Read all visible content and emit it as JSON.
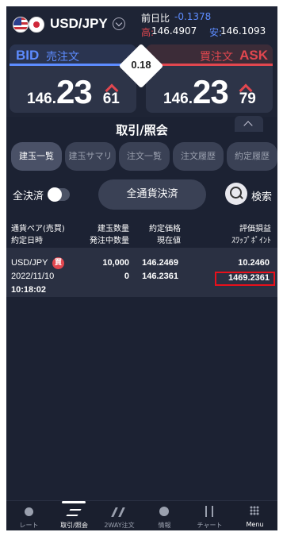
{
  "header": {
    "pair": "USD/JPY",
    "change_label": "前日比",
    "change_value": "-0.1378",
    "high_label": "高:",
    "high_value": "146.4907",
    "low_label": "安:",
    "low_value": "146.1093"
  },
  "bid": {
    "label": "BID",
    "sub": "売注文",
    "price_head": "146.",
    "price_big": "23",
    "price_tail": "61"
  },
  "ask": {
    "label": "ASK",
    "sub": "買注文",
    "price_head": "146.",
    "price_big": "23",
    "price_tail": "79"
  },
  "spread": "0.18",
  "panel_title": "取引/照会",
  "tabs": [
    "建玉一覧",
    "建玉サマリ",
    "注文一覧",
    "注文履歴",
    "約定履歴"
  ],
  "controls": {
    "settle_all_label": "全決済",
    "all_currency_button": "全通貨決済",
    "search_label": "検索"
  },
  "table": {
    "headers": {
      "col1_line1": "通貨ペア(売買)",
      "col1_line2": "約定日時",
      "col2_line1": "建玉数量",
      "col2_line2": "発注中数量",
      "col3_line1": "約定価格",
      "col3_line2": "現在値",
      "col4_line1": "評価損益",
      "col4_line2": "ｽﾜｯﾌﾟﾎﾟｲﾝﾄ"
    },
    "rows": [
      {
        "pair": "USD/JPY",
        "side": "買",
        "date": "2022/11/10",
        "time": "10:18:02",
        "qty": "10,000",
        "pending_qty": "0",
        "exec_price": "146.2469",
        "current_price": "146.2361",
        "pl": "10.2460",
        "swap": "1469.2361"
      }
    ]
  },
  "nav": [
    {
      "label": "レート",
      "icon": "rate-icon"
    },
    {
      "label": "取引/照会",
      "icon": "trade-icon"
    },
    {
      "label": "2WAY注文",
      "icon": "two-way-icon"
    },
    {
      "label": "情報",
      "icon": "info-icon"
    },
    {
      "label": "チャート",
      "icon": "chart-icon"
    },
    {
      "label": "Menu",
      "icon": "menu-icon"
    }
  ],
  "colors": {
    "bid": "#5d8cff",
    "ask": "#e2474f",
    "highlight_box": "#e8101b",
    "background": "#1e2435"
  }
}
